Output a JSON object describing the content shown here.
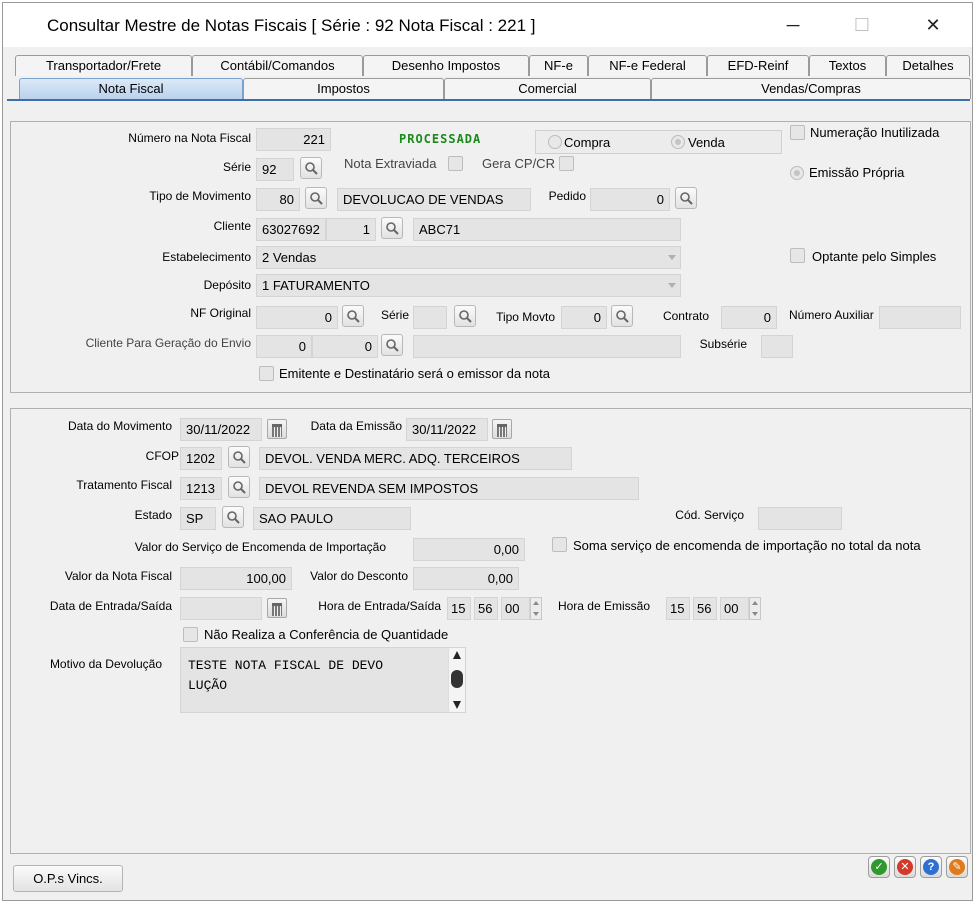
{
  "window": {
    "title": "Consultar Mestre de Notas Fiscais [ Série : 92  Nota Fiscal : 221 ]",
    "minimize": "─",
    "maximize": "☐",
    "close": "✕"
  },
  "tabs_row1": [
    "Transportador/Frete",
    "Contábil/Comandos",
    "Desenho Impostos",
    "NF-e",
    "NF-e Federal",
    "EFD-Reinf",
    "Textos",
    "Detalhes"
  ],
  "tabs_row2": [
    "Nota Fiscal",
    "Impostos",
    "Comercial",
    "Vendas/Compras"
  ],
  "selected_tab": "Nota Fiscal",
  "top": {
    "numero_label": "Número na Nota Fiscal",
    "numero_value": "221",
    "status": "PROCESSADA",
    "status_color": "#1a8a1a",
    "compra_label": "Compra",
    "venda_label": "Venda",
    "tipo_operacao_selected": "Venda",
    "numeracao_inutilizada_label": "Numeração Inutilizada",
    "serie_label": "Série",
    "serie_value": "92",
    "nota_extraviada_label": "Nota Extraviada",
    "gera_cpcr_label": "Gera CP/CR",
    "emissao_propria_label": "Emissão Própria",
    "tipo_movimento_label": "Tipo de Movimento",
    "tipo_movimento_code": "80",
    "tipo_movimento_desc": "DEVOLUCAO DE VENDAS",
    "pedido_label": "Pedido",
    "pedido_value": "0",
    "cliente_label": "Cliente",
    "cliente_code": "63027692",
    "cliente_seq": "1",
    "cliente_name": "ABC71",
    "estabelecimento_label": "Estabelecimento",
    "estabelecimento_value": "2 Vendas",
    "optante_simples_label": "Optante pelo Simples",
    "deposito_label": "Depósito",
    "deposito_value": "1 FATURAMENTO",
    "nf_original_label": "NF Original",
    "nf_original_value": "0",
    "serie2_label": "Série",
    "serie2_value": "",
    "tipo_movto_label": "Tipo Movto",
    "tipo_movto_value": "0",
    "contrato_label": "Contrato",
    "contrato_value": "0",
    "numero_auxiliar_label": "Número Auxiliar",
    "numero_auxiliar_value": "",
    "cliente_envio_label": "Cliente Para Geração do Envio",
    "cliente_envio_code": "0",
    "cliente_envio_seq": "0",
    "cliente_envio_name": "",
    "subserie_label": "Subsérie",
    "subserie_value": "",
    "emitente_label": "Emitente e Destinatário será o emissor da nota"
  },
  "bottom": {
    "data_movimento_label": "Data do Movimento",
    "data_movimento_value": "30/11/2022",
    "data_emissao_label": "Data da Emissão",
    "data_emissao_value": "30/11/2022",
    "cfop_label": "CFOP",
    "cfop_code": "1202",
    "cfop_desc": "DEVOL. VENDA MERC. ADQ. TERCEIROS",
    "tratamento_label": "Tratamento Fiscal",
    "tratamento_code": "1213",
    "tratamento_desc": "DEVOL REVENDA SEM IMPOSTOS",
    "estado_label": "Estado",
    "estado_code": "SP",
    "estado_name": "SAO PAULO",
    "cod_servico_label": "Cód. Serviço",
    "cod_servico_value": "",
    "valor_encomenda_label": "Valor do Serviço de Encomenda de Importação",
    "valor_encomenda_value": "0,00",
    "soma_servico_label": "Soma serviço de encomenda de importação no total da nota",
    "valor_nf_label": "Valor da Nota Fiscal",
    "valor_nf_value": "100,00",
    "valor_desconto_label": "Valor do Desconto",
    "valor_desconto_value": "0,00",
    "data_entrada_label": "Data de Entrada/Saída",
    "data_entrada_value": "",
    "hora_entrada_label": "Hora de Entrada/Saída",
    "hora_entrada_h": "15",
    "hora_entrada_m": "56",
    "hora_entrada_s": "00",
    "hora_emissao_label": "Hora de Emissão",
    "hora_emissao_h": "15",
    "hora_emissao_m": "56",
    "hora_emissao_s": "00",
    "nao_conferencia_label": "Não Realiza a Conferência de Quantidade",
    "motivo_label": "Motivo da Devolução",
    "motivo_value": "TESTE NOTA FISCAL DE DEVO\nLUÇÃO"
  },
  "footer": {
    "ops_label": "O.P.s Vincs.",
    "ok_icon": "✓",
    "cancel_icon": "✕",
    "help_icon": "?",
    "tools_icon": "✎"
  },
  "icons": {
    "search": "search-icon",
    "calendar": "calendar-icon",
    "ok_color": "#2e9a2e",
    "cancel_color": "#d43a2a",
    "help_color": "#2f6fcf",
    "tools_color": "#e07a1a"
  }
}
